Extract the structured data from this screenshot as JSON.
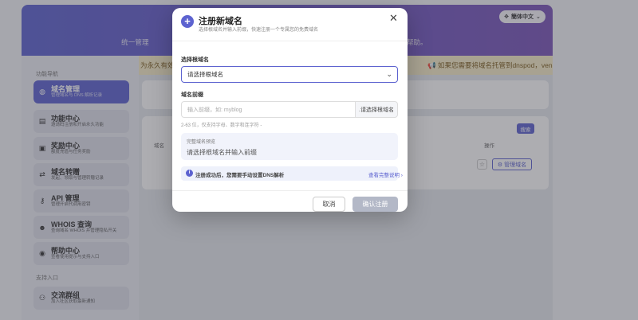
{
  "lang_button": "簡体中文",
  "hero": {
    "slogan_left": "统一管理",
    "slogan_right": "帮助。"
  },
  "notice": {
    "left": "为永久有效",
    "right": "如果您需要将域名托管到dnspod，ven"
  },
  "sidebar": {
    "section_nav": "功能导航",
    "section_support": "支持入口",
    "items": [
      {
        "label": "域名管理",
        "sub": "管理域名与 DNS 解析记录",
        "icon": "globe-icon"
      },
      {
        "label": "功能中心",
        "sub": "邀请码注册和开启永久功能",
        "icon": "briefcase-icon"
      },
      {
        "label": "奖励中心",
        "sub": "额度充值与任务奖励",
        "icon": "gift-icon"
      },
      {
        "label": "域名转赠",
        "sub": "发起、领取与管理转赠记录",
        "icon": "transfer-icon"
      },
      {
        "label": "API 管理",
        "sub": "管理开启代调用密钥",
        "icon": "key-icon"
      },
      {
        "label": "WHOIS 查询",
        "sub": "查询域名 WHOIS 并管理隐私开关",
        "icon": "user-search-icon"
      },
      {
        "label": "帮助中心",
        "sub": "查看使用提示与支持入口",
        "icon": "help-icon"
      },
      {
        "label": "交流群组",
        "sub": "加入社区获取最新通知",
        "icon": "group-icon"
      }
    ]
  },
  "main": {
    "search_label": "搜索",
    "col_domain": "域名",
    "col_actions": "操作",
    "manage_label": "管理域名"
  },
  "modal": {
    "title": "注册新域名",
    "subtitle": "选择根域名并输入前缀，快速注册一个专属您的免费域名",
    "root_label": "选择根域名",
    "root_value": "请选择根域名",
    "prefix_label": "域名前缀",
    "prefix_placeholder": "输入前缀，如: myblog",
    "prefix_suffix": ".请选择根域名",
    "hint": "2-63 位，仅支持字母、数字和连字符 -",
    "preview_label": "完整域名预览",
    "preview_value": "请选择根域名并输入前缀",
    "info_text": "注册成功后，您需要手动设置DNS解析",
    "info_link": "查看完整说明 ›",
    "cancel": "取消",
    "confirm": "确认注册"
  }
}
